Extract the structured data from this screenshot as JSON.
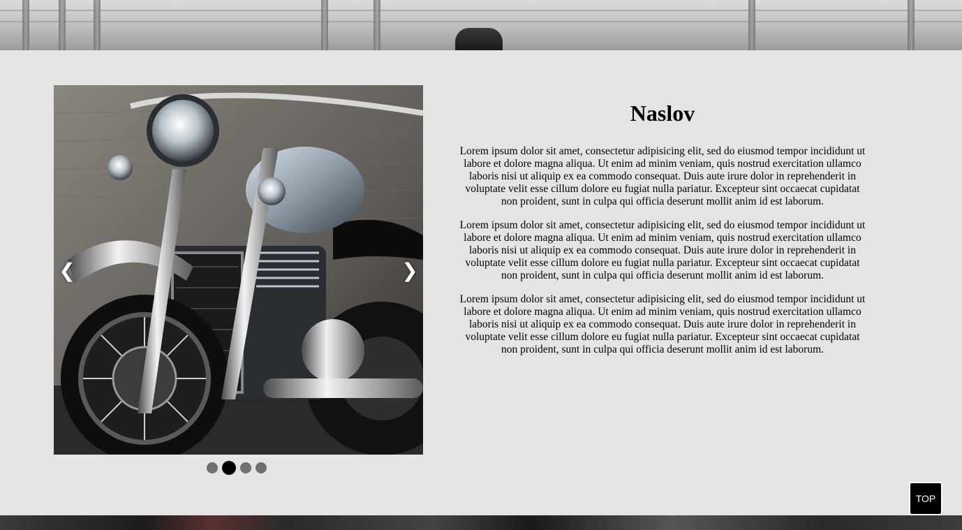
{
  "article": {
    "title": "Naslov",
    "paragraphs": [
      "Lorem ipsum dolor sit amet, consectetur adipisicing elit, sed do eiusmod tempor incididunt ut labore et dolore magna aliqua. Ut enim ad minim veniam, quis nostrud exercitation ullamco laboris nisi ut aliquip ex ea commodo consequat. Duis aute irure dolor in reprehenderit in voluptate velit esse cillum dolore eu fugiat nulla pariatur. Excepteur sint occaecat cupidatat non proident, sunt in culpa qui officia deserunt mollit anim id est laborum.",
      "Lorem ipsum dolor sit amet, consectetur adipisicing elit, sed do eiusmod tempor incididunt ut labore et dolore magna aliqua. Ut enim ad minim veniam, quis nostrud exercitation ullamco laboris nisi ut aliquip ex ea commodo consequat. Duis aute irure dolor in reprehenderit in voluptate velit esse cillum dolore eu fugiat nulla pariatur. Excepteur sint occaecat cupidatat non proident, sunt in culpa qui officia deserunt mollit anim id est laborum.",
      "Lorem ipsum dolor sit amet, consectetur adipisicing elit, sed do eiusmod tempor incididunt ut labore et dolore magna aliqua. Ut enim ad minim veniam, quis nostrud exercitation ullamco laboris nisi ut aliquip ex ea commodo consequat. Duis aute irure dolor in reprehenderit in voluptate velit esse cillum dolore eu fugiat nulla pariatur. Excepteur sint occaecat cupidatat non proident, sunt in culpa qui officia deserunt mollit anim id est laborum."
    ]
  },
  "slider": {
    "prev_icon": "❮",
    "next_icon": "❯",
    "slide_count": 4,
    "active_index": 1,
    "image_subject": "motorcycle-photo"
  },
  "back_to_top": {
    "label": "TOP"
  },
  "colors": {
    "panel_background": "#e4e4e4",
    "active_dot": "#000000",
    "inactive_dot": "#6f6f6f",
    "top_button": "#000000"
  }
}
